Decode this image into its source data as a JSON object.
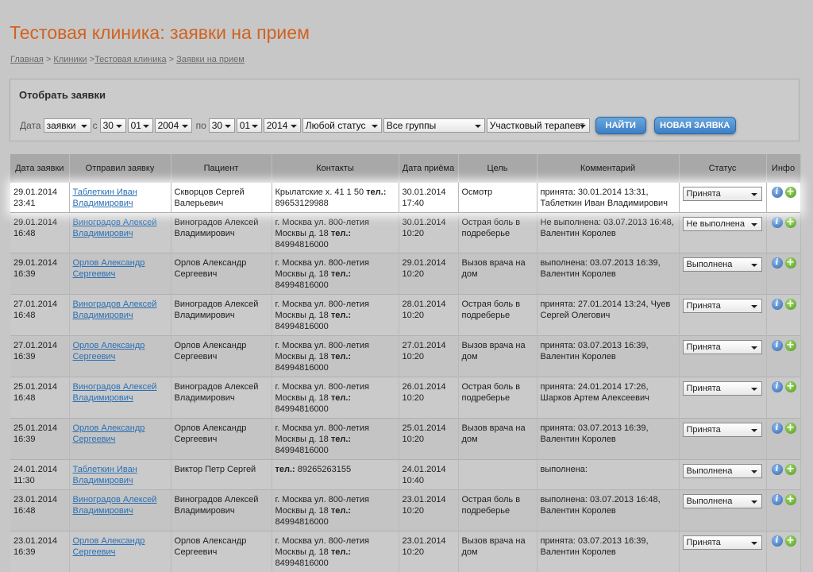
{
  "page": {
    "title": "Тестовая клиника: заявки на прием",
    "breadcrumbs": [
      "Главная",
      "Клиники",
      "Тестовая клиника",
      "Заявки на прием"
    ]
  },
  "filter": {
    "title": "Отобрать заявки",
    "date_label": "Дата",
    "date_type": "заявки",
    "from_label": "с",
    "from_day": "30",
    "from_month": "01",
    "from_year": "2004",
    "to_label": "по",
    "to_day": "30",
    "to_month": "01",
    "to_year": "2014",
    "status": "Любой статус",
    "group": "Все группы",
    "doctor": "Участковый терапевт",
    "find_button": "Найти",
    "new_button": "Новая заявка"
  },
  "table": {
    "headers": [
      "Дата заявки",
      "Отправил заявку",
      "Пациент",
      "Контакты",
      "Дата приёма",
      "Цель",
      "Комментарий",
      "Статус",
      "Инфо"
    ],
    "phone_label": "тел.:",
    "rows": [
      {
        "req_date": "29.01.2014",
        "req_time": "23:41",
        "sender": "Таблеткин Иван Владимирович",
        "patient": "Скворцов Сергей Валерьевич",
        "address": "Крылатские х. 41 1 50",
        "phone": "89653129988",
        "visit_date": "30.01.2014",
        "visit_time": "17:40",
        "purpose": "Осмотр",
        "comment": "принята: 30.01.2014 13:31, Таблеткин Иван Владимирович",
        "status": "Принята"
      },
      {
        "req_date": "29.01.2014",
        "req_time": "16:48",
        "sender": "Виноградов Алексей Владимирович",
        "patient": "Виноградов Алексей Владимирович",
        "address": "г. Москва ул. 800-летия Москвы д. 18",
        "phone": "84994816000",
        "visit_date": "30.01.2014",
        "visit_time": "10:20",
        "purpose": "Острая боль в подреберье",
        "comment": "Не выполнена: 03.07.2013 16:48, Валентин Королев",
        "status": "Не выполнена"
      },
      {
        "req_date": "29.01.2014",
        "req_time": "16:39",
        "sender": "Орлов Александр Сергеевич",
        "patient": "Орлов Александр Сергеевич",
        "address": "г. Москва ул. 800-летия Москвы д. 18",
        "phone": "84994816000",
        "visit_date": "29.01.2014",
        "visit_time": "10:20",
        "purpose": "Вызов врача на дом",
        "comment": "выполнена: 03.07.2013 16:39, Валентин Королев",
        "status": "Выполнена"
      },
      {
        "req_date": "27.01.2014",
        "req_time": "16:48",
        "sender": "Виноградов Алексей Владимирович",
        "patient": "Виноградов Алексей Владимирович",
        "address": "г. Москва ул. 800-летия Москвы д. 18",
        "phone": "84994816000",
        "visit_date": "28.01.2014",
        "visit_time": "10:20",
        "purpose": "Острая боль в подреберье",
        "comment": "принята: 27.01.2014 13:24, Чуев Сергей Олегович",
        "status": "Принята"
      },
      {
        "req_date": "27.01.2014",
        "req_time": "16:39",
        "sender": "Орлов Александр Сергеевич",
        "patient": "Орлов Александр Сергеевич",
        "address": "г. Москва ул. 800-летия Москвы д. 18",
        "phone": "84994816000",
        "visit_date": "27.01.2014",
        "visit_time": "10:20",
        "purpose": "Вызов врача на дом",
        "comment": "принята: 03.07.2013 16:39, Валентин Королев",
        "status": "Принята"
      },
      {
        "req_date": "25.01.2014",
        "req_time": "16:48",
        "sender": "Виноградов Алексей Владимирович",
        "patient": "Виноградов Алексей Владимирович",
        "address": "г. Москва ул. 800-летия Москвы д. 18",
        "phone": "84994816000",
        "visit_date": "26.01.2014",
        "visit_time": "10:20",
        "purpose": "Острая боль в подреберье",
        "comment": "принята: 24.01.2014 17:26, Шарков Артем Алексеевич",
        "status": "Принята"
      },
      {
        "req_date": "25.01.2014",
        "req_time": "16:39",
        "sender": "Орлов Александр Сергеевич",
        "patient": "Орлов Александр Сергеевич",
        "address": "г. Москва ул. 800-летия Москвы д. 18",
        "phone": "84994816000",
        "visit_date": "25.01.2014",
        "visit_time": "10:20",
        "purpose": "Вызов врача на дом",
        "comment": "принята: 03.07.2013 16:39, Валентин Королев",
        "status": "Принята"
      },
      {
        "req_date": "24.01.2014",
        "req_time": "11:30",
        "sender": "Таблеткин Иван Владимирович",
        "patient": "Виктор Петр Сергей",
        "address": "",
        "phone": "89265263155",
        "visit_date": "24.01.2014",
        "visit_time": "10:40",
        "purpose": "",
        "comment": "выполнена:",
        "status": "Выполнена"
      },
      {
        "req_date": "23.01.2014",
        "req_time": "16:48",
        "sender": "Виноградов Алексей Владимирович",
        "patient": "Виноградов Алексей Владимирович",
        "address": "г. Москва ул. 800-летия Москвы д. 18",
        "phone": "84994816000",
        "visit_date": "23.01.2014",
        "visit_time": "10:20",
        "purpose": "Острая боль в подреберье",
        "comment": "выполнена: 03.07.2013 16:48, Валентин Королев",
        "status": "Выполнена"
      },
      {
        "req_date": "23.01.2014",
        "req_time": "16:39",
        "sender": "Орлов Александр Сергеевич",
        "patient": "Орлов Александр Сергеевич",
        "address": "г. Москва ул. 800-летия Москвы д. 18",
        "phone": "84994816000",
        "visit_date": "23.01.2014",
        "visit_time": "10:20",
        "purpose": "Вызов врача на дом",
        "comment": "принята: 03.07.2013 16:39, Валентин Королев",
        "status": "Принята"
      }
    ]
  }
}
